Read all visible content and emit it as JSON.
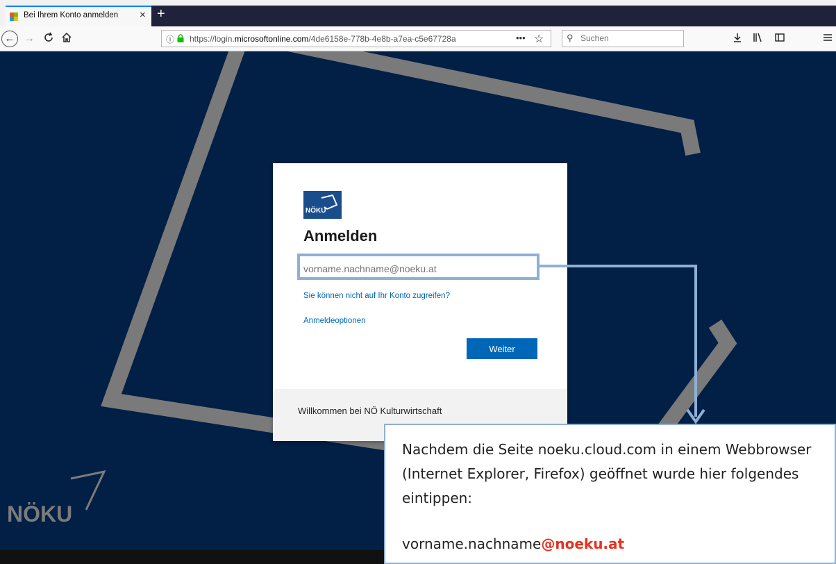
{
  "browser": {
    "tab_title": "Bei Ihrem Konto anmelden",
    "tab_close": "×",
    "new_tab": "+",
    "url_prefix": "https://login.",
    "url_domain": "microsoftonline.com",
    "url_rest": "/4de6158e-778b-4e8b-a7ea-c5e67728a",
    "search_placeholder": "Suchen",
    "page_actions": "•••"
  },
  "login": {
    "brand": "NÖKU",
    "heading": "Anmelden",
    "email_placeholder": "vorname.nachname@noeku.at",
    "cant_access_link": "Sie können nicht auf Ihr Konto zugreifen?",
    "options_link": "Anmeldeoptionen",
    "next_button": "Weiter",
    "welcome": "Willkommen bei NÖ Kulturwirtschaft"
  },
  "watermark": {
    "brand": "NÖKU"
  },
  "callout": {
    "instruction": "Nachdem die Seite noeku.cloud.com in einem Webbrowser (Internet Explorer, Firefox) geöffnet wurde hier folgendes eintippen:",
    "email_user": "vorname.nachname",
    "email_domain": "@noeku.at"
  },
  "colors": {
    "page_bg": "#021f45",
    "accent": "#0067b8",
    "highlight": "#8fb0d6",
    "email_domain": "#e8301f"
  }
}
